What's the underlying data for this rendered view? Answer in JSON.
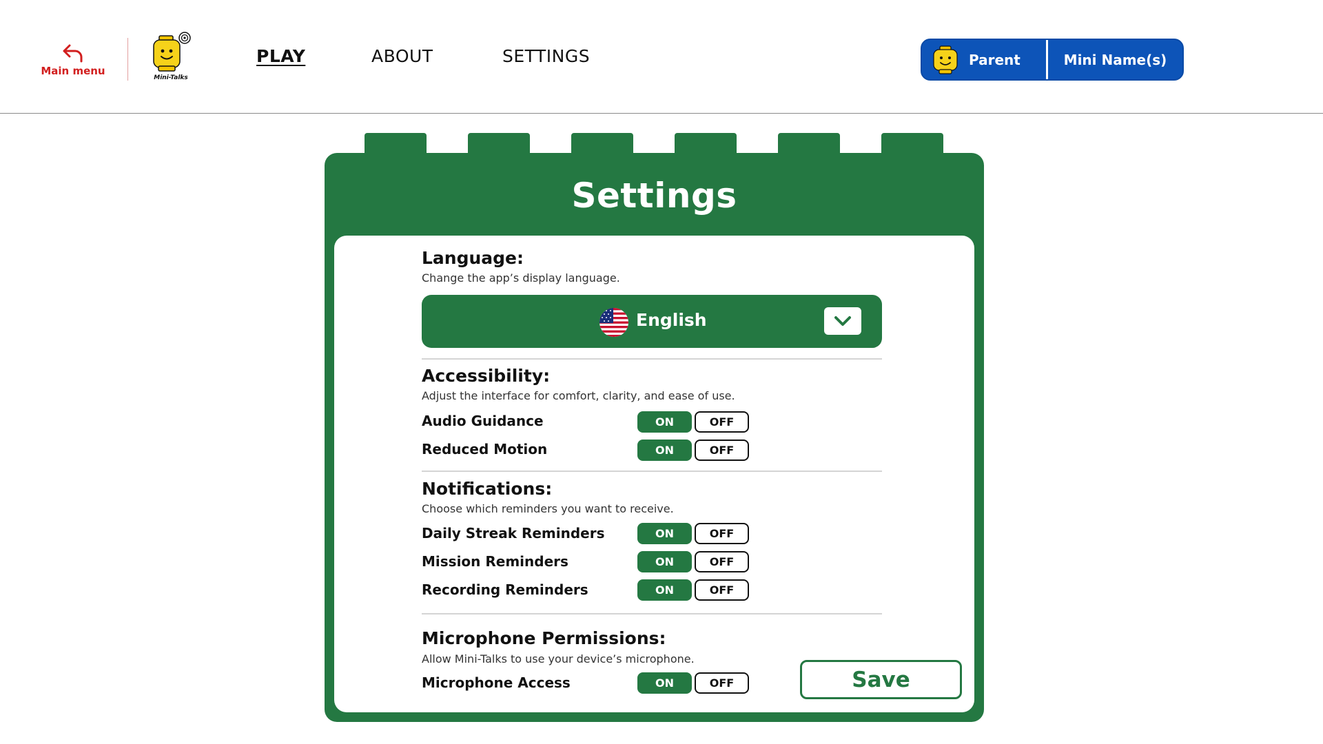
{
  "header": {
    "main_menu_label": "Main menu",
    "logo_text": "Mini-Talks",
    "nav": [
      {
        "label": "PLAY",
        "active": true
      },
      {
        "label": "ABOUT",
        "active": false
      },
      {
        "label": "SETTINGS",
        "active": false
      }
    ],
    "profile": {
      "parent_label": "Parent",
      "mini_label": "Mini Name(s)"
    }
  },
  "colors": {
    "brand_green": "#247842",
    "profile_blue": "#0d54b8",
    "main_menu_red": "#d21f1f"
  },
  "settings": {
    "title": "Settings",
    "language": {
      "title": "Language:",
      "description": "Change the app’s display language.",
      "selected": "English",
      "flag_icon": "us-flag-icon"
    },
    "accessibility": {
      "title": "Accessibility:",
      "description": "Adjust the interface for comfort, clarity, and ease of use.",
      "rows": [
        {
          "label": "Audio Guidance",
          "on": "ON",
          "off": "OFF",
          "state": "on"
        },
        {
          "label": "Reduced Motion",
          "on": "ON",
          "off": "OFF",
          "state": "on"
        }
      ]
    },
    "notifications": {
      "title": "Notifications:",
      "description": "Choose which reminders you want to receive.",
      "rows": [
        {
          "label": "Daily Streak Reminders",
          "on": "ON",
          "off": "OFF",
          "state": "on"
        },
        {
          "label": "Mission Reminders",
          "on": "ON",
          "off": "OFF",
          "state": "on"
        },
        {
          "label": "Recording Reminders",
          "on": "ON",
          "off": "OFF",
          "state": "on"
        }
      ]
    },
    "microphone": {
      "title": "Microphone Permissions:",
      "description": "Allow Mini-Talks to use your device’s microphone.",
      "rows": [
        {
          "label": "Microphone Access",
          "on": "ON",
          "off": "OFF",
          "state": "on"
        }
      ]
    },
    "save_label": "Save"
  }
}
